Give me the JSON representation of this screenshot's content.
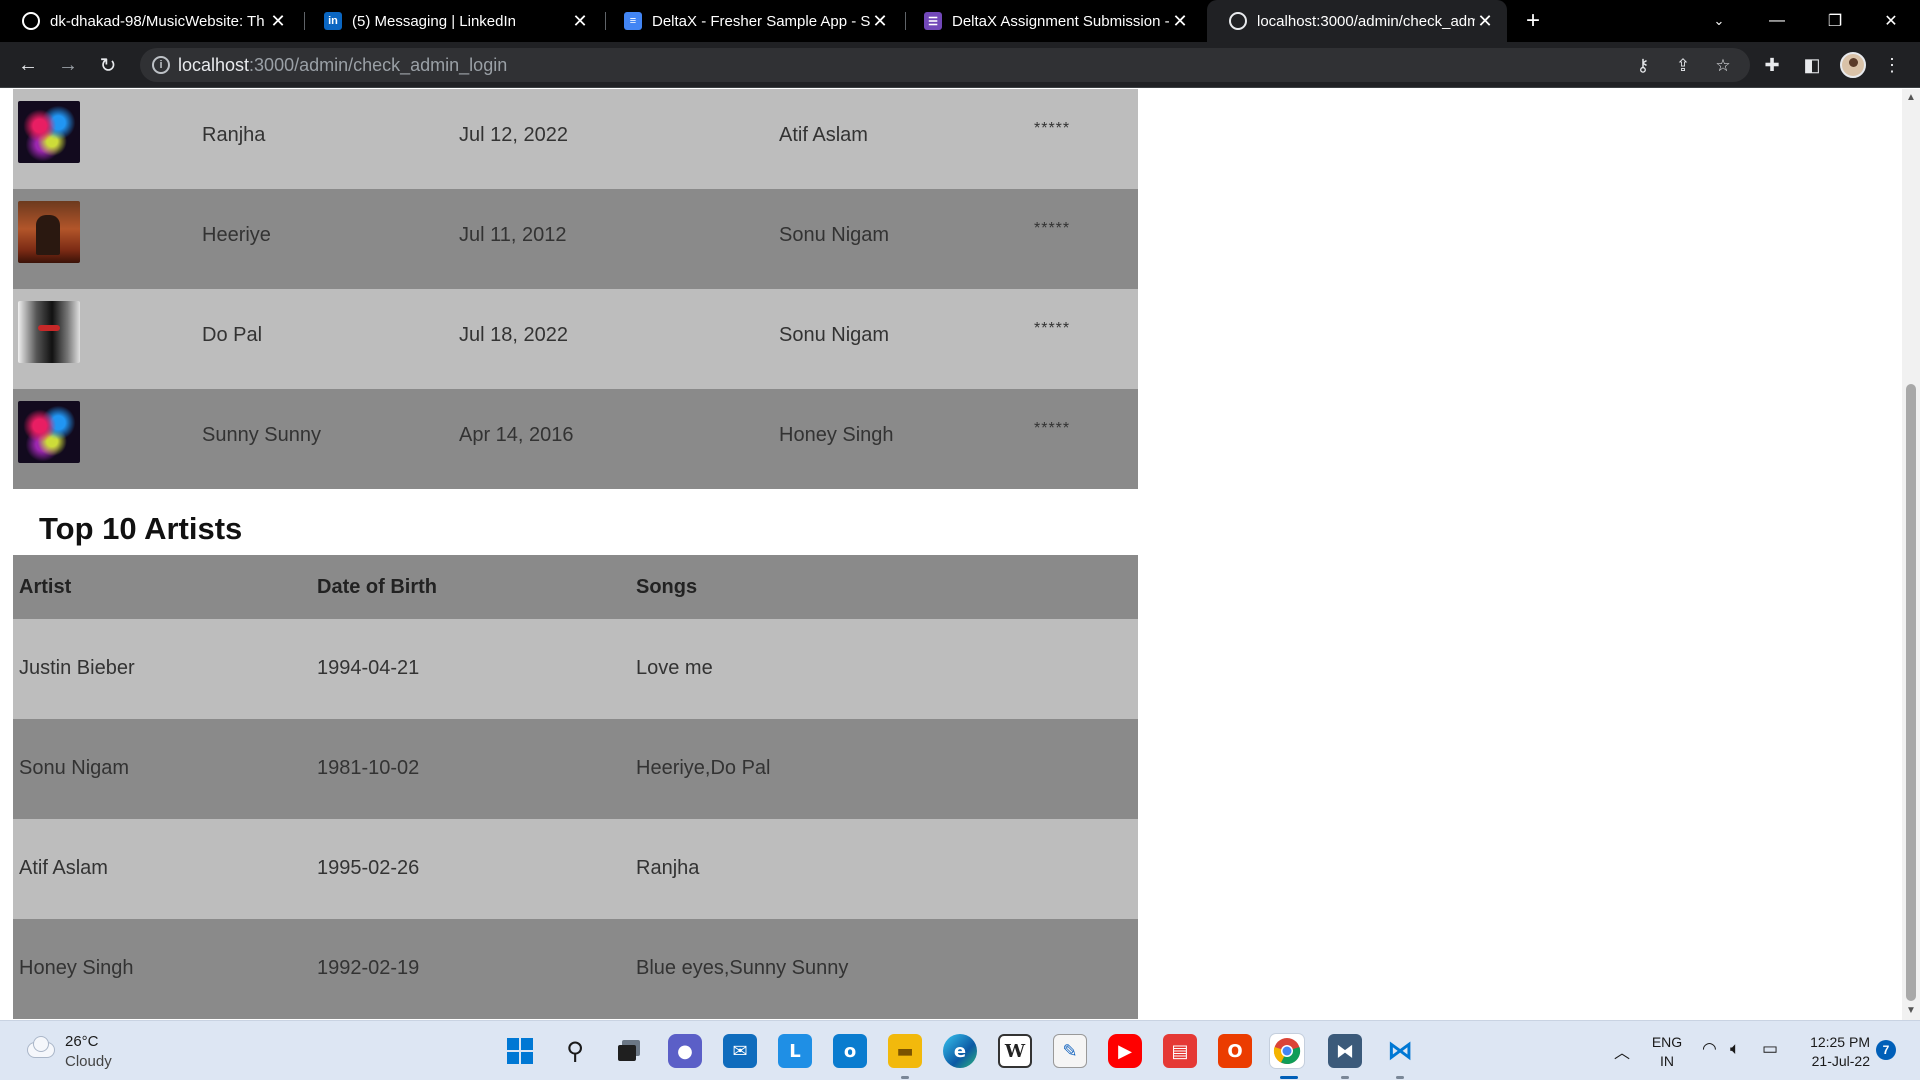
{
  "browser": {
    "tabs": [
      {
        "title": "dk-dhakad-98/MusicWebsite: Th",
        "icon": "github-icon",
        "color": "#ffffff",
        "active": false
      },
      {
        "title": "(5) Messaging | LinkedIn",
        "icon": "linkedin-icon",
        "color": "#0a66c2",
        "active": false
      },
      {
        "title": "DeltaX - Fresher Sample App - Sp",
        "icon": "google-docs-icon",
        "color": "#4285f4",
        "active": false
      },
      {
        "title": "DeltaX Assignment Submission -",
        "icon": "google-forms-icon",
        "color": "#7248b9",
        "active": false
      },
      {
        "title": "localhost:3000/admin/check_adm",
        "icon": "globe-icon",
        "color": "#e8eaed",
        "active": true
      }
    ],
    "url_host": "localhost",
    "url_rest": ":3000/admin/check_admin_login"
  },
  "songs": [
    {
      "name": "Ranjha",
      "date": "Jul 12, 2022",
      "artist": "Atif Aslam",
      "rating": "*****",
      "cover": "cover-a"
    },
    {
      "name": "Heeriye",
      "date": "Jul 11, 2012",
      "artist": "Sonu Nigam",
      "rating": "*****",
      "cover": "cover-b"
    },
    {
      "name": "Do Pal",
      "date": "Jul 18, 2022",
      "artist": "Sonu Nigam",
      "rating": "*****",
      "cover": "cover-c"
    },
    {
      "name": "Sunny Sunny",
      "date": "Apr 14, 2016",
      "artist": "Honey Singh",
      "rating": "*****",
      "cover": "cover-a"
    }
  ],
  "artists_section": {
    "title": "Top 10 Artists",
    "headers": [
      "Artist",
      "Date of Birth",
      "Songs"
    ],
    "rows": [
      {
        "artist": "Justin Bieber",
        "dob": "1994-04-21",
        "songs": "Love me"
      },
      {
        "artist": "Sonu Nigam",
        "dob": "1981-10-02",
        "songs": "Heeriye,Do Pal"
      },
      {
        "artist": "Atif Aslam",
        "dob": "1995-02-26",
        "songs": "Ranjha"
      },
      {
        "artist": "Honey Singh",
        "dob": "1992-02-19",
        "songs": "Blue eyes,Sunny Sunny"
      }
    ]
  },
  "taskbar": {
    "weather_temp": "26°C",
    "weather_condition": "Cloudy",
    "lang_line1": "ENG",
    "lang_line2": "IN",
    "time": "12:25 PM",
    "date": "21-Jul-22",
    "notification_count": "7"
  },
  "colors": {
    "row_light": "#bdbdbd",
    "row_dark": "#8a8a8a",
    "taskbar_bg": "#dde6f3",
    "accent": "#005fb8"
  }
}
